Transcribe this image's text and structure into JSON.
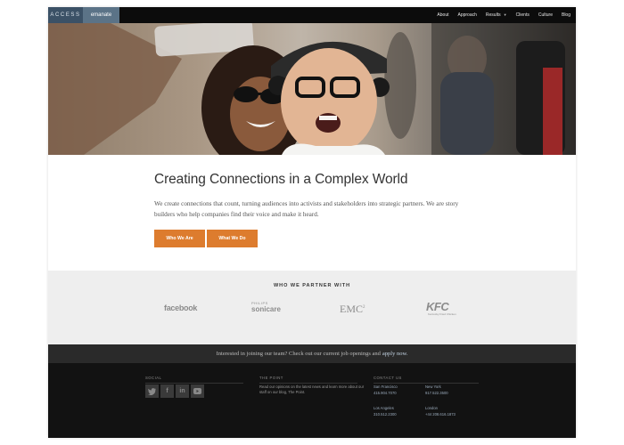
{
  "header": {
    "logo_left": "ACCESS",
    "logo_right": "emanate",
    "nav": [
      {
        "label": "About"
      },
      {
        "label": "Approach"
      },
      {
        "label": "Results",
        "has_dropdown": true
      },
      {
        "label": "Clients"
      },
      {
        "label": "Culture"
      },
      {
        "label": "Blog"
      }
    ]
  },
  "intro": {
    "title": "Creating Connections in a Complex World",
    "body": "We create connections that count, turning audiences into activists and stakeholders into strategic partners. We are story builders who help companies find their voice and make it heard.",
    "buttons": [
      {
        "label": "Who We Are"
      },
      {
        "label": "What We Do"
      }
    ]
  },
  "partners": {
    "heading": "WHO WE PARTNER WITH",
    "logos": {
      "facebook": "facebook",
      "philips": "PHILIPS",
      "sonicare": "sonicare",
      "emc": "EMC",
      "emc_sup": "2",
      "kfc": "KFC",
      "kfc_tag": "Kentucky Fried Chicken"
    }
  },
  "join": {
    "text": "Interested in joining our team? Check out our current job openings and",
    "link": "apply now."
  },
  "footer": {
    "social_title": "SOCIAL",
    "social_icons": [
      "twitter-icon",
      "facebook-icon",
      "linkedin-icon",
      "youtube-icon"
    ],
    "point_title": "THE POINT",
    "point_text": "Read our opinions on the latest news and learn more about our staff on our blog, The Point.",
    "contact_title": "CONTACT US",
    "offices": [
      {
        "city": "San Francisco",
        "phone": "415.904.7070"
      },
      {
        "city": "New York",
        "phone": "917.522.3500"
      },
      {
        "city": "Los Angeles",
        "phone": "310.512.2300"
      },
      {
        "city": "London",
        "phone": "+44 208.616.1873"
      }
    ]
  },
  "colors": {
    "accent_orange": "#dd7c2e",
    "header_bg": "#0c0c0c",
    "logo_blue": "#3b5166",
    "footer_bg": "#121212"
  }
}
